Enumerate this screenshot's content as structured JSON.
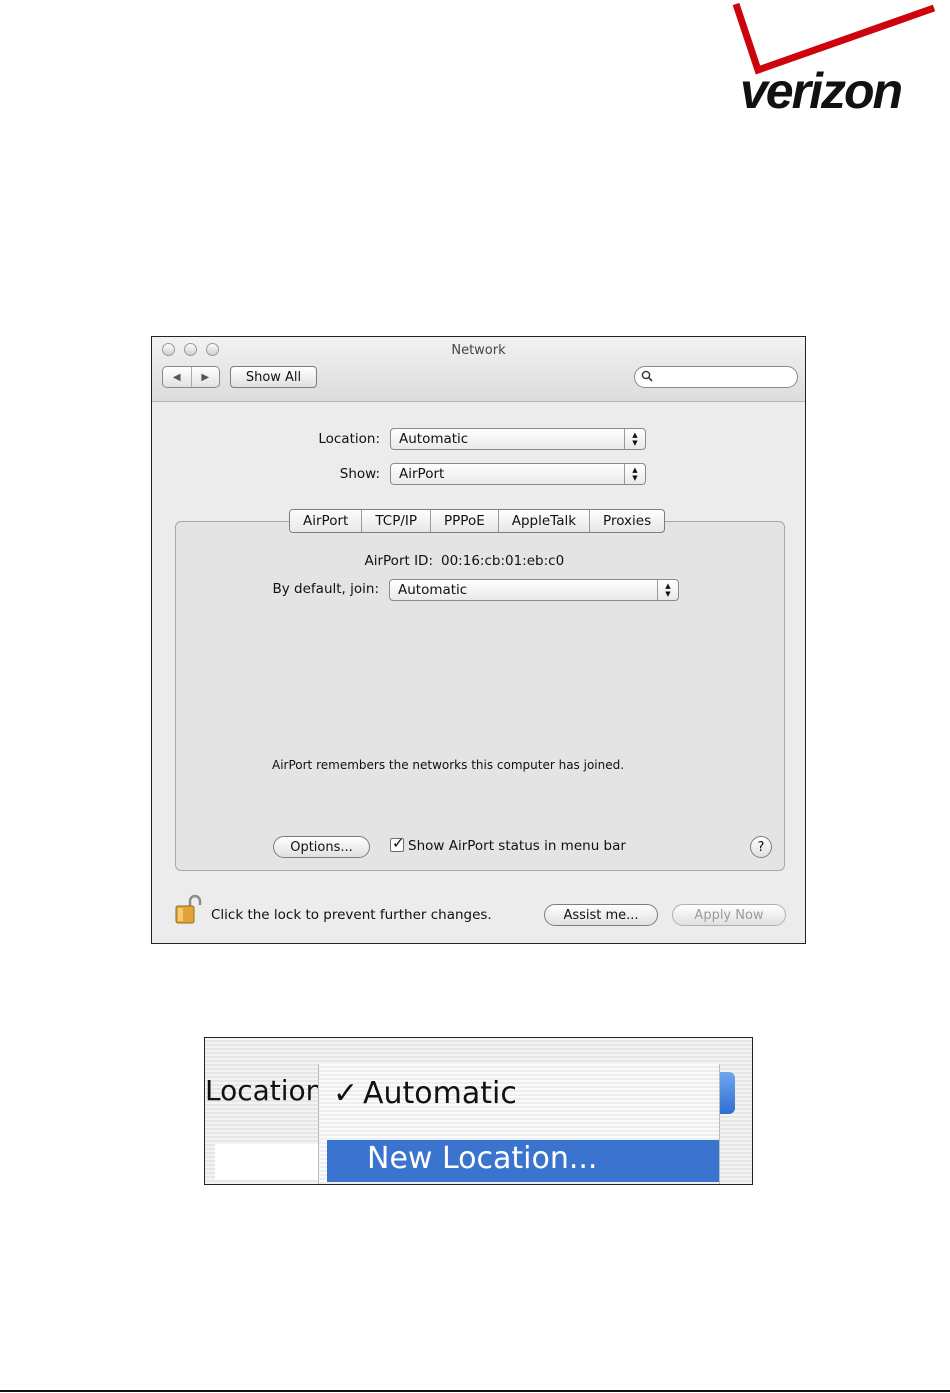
{
  "logo": {
    "text": "verizon",
    "accent_color": "#cd040b"
  },
  "network_window": {
    "title": "Network",
    "toolbar": {
      "back": "◀",
      "forward": "▶",
      "show_all": "Show All",
      "search_placeholder": ""
    },
    "location": {
      "label": "Location:",
      "value": "Automatic"
    },
    "show": {
      "label": "Show:",
      "value": "AirPort"
    },
    "tabs": [
      {
        "label": "AirPort",
        "selected": true
      },
      {
        "label": "TCP/IP",
        "selected": false
      },
      {
        "label": "PPPoE",
        "selected": false
      },
      {
        "label": "AppleTalk",
        "selected": false
      },
      {
        "label": "Proxies",
        "selected": false
      }
    ],
    "airport_id": {
      "label": "AirPort ID:",
      "value": "00:16:cb:01:eb:c0"
    },
    "default_join": {
      "label": "By default, join:",
      "value": "Automatic"
    },
    "remembers_note": "AirPort remembers the networks this computer has joined.",
    "options_button": "Options...",
    "show_status": {
      "label": "Show AirPort status in menu bar",
      "checked": true
    },
    "help": "?",
    "lock_note": "Click the lock to prevent further changes.",
    "assist_button": "Assist me...",
    "apply_button": "Apply Now"
  },
  "location_menu": {
    "label": "Location",
    "items": [
      {
        "label": "Automatic",
        "checked": true,
        "highlighted": false
      },
      {
        "label": "New Location...",
        "checked": false,
        "highlighted": true
      }
    ],
    "highlight_color": "#3a74cf"
  }
}
